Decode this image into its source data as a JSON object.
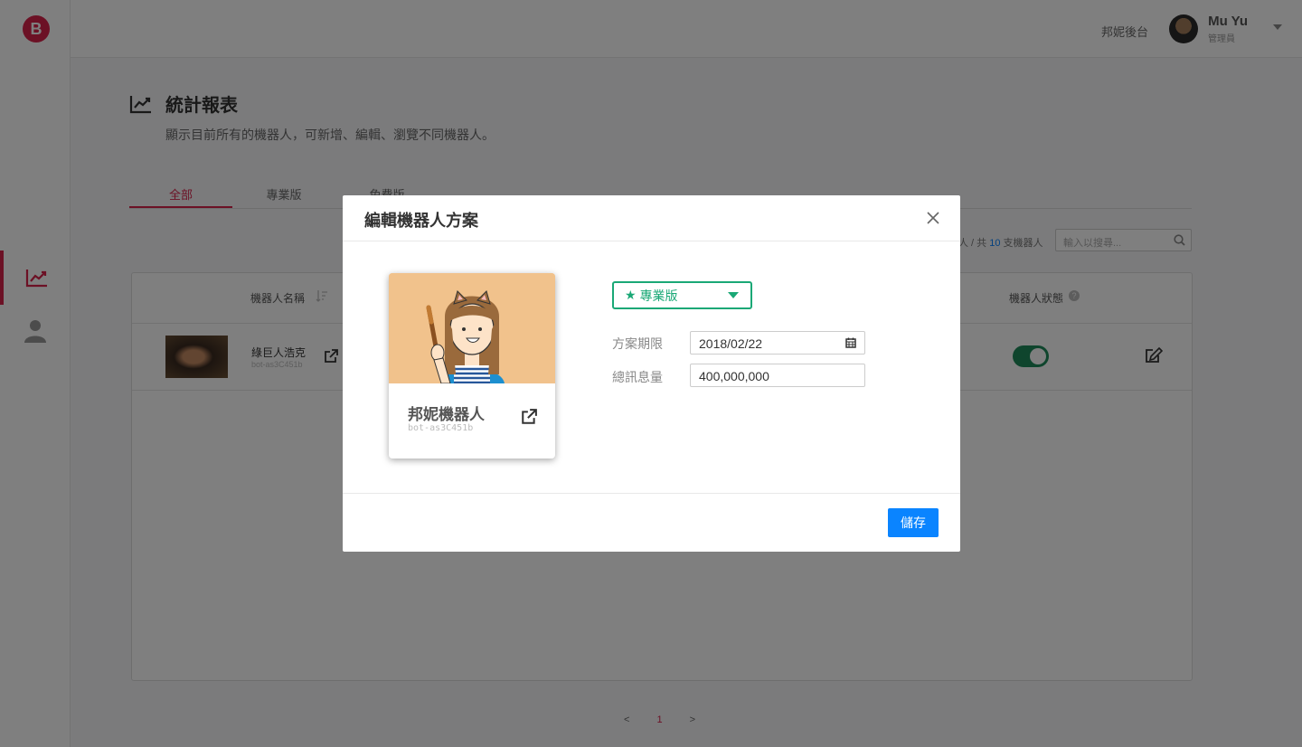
{
  "sidebar": {
    "logo_letter": "B",
    "items": [
      {
        "icon": "chart-line-icon",
        "active": true
      },
      {
        "icon": "user-icon",
        "active": false
      }
    ]
  },
  "header": {
    "backend_label": "邦妮後台",
    "user_name": "Mu Yu",
    "user_role": "管理員"
  },
  "page": {
    "title": "統計報表",
    "description": "顯示目前所有的機器人，可新增、編輯、瀏覽不同機器人。",
    "tabs": [
      "全部",
      "專業版",
      "免費版"
    ],
    "active_tab": 0,
    "count_prefix": "人 / 共",
    "count_value": "10",
    "count_suffix": "支機器人",
    "search_placeholder": "輸入以搜尋..."
  },
  "table": {
    "columns": {
      "name": "機器人名稱",
      "status": "機器人狀態"
    },
    "rows": [
      {
        "name": "綠巨人浩克",
        "id": "bot-as3C451b",
        "status_on": true
      }
    ]
  },
  "pagination": {
    "prev": "<",
    "current": "1",
    "next": ">"
  },
  "modal": {
    "title": "編輯機器人方案",
    "card": {
      "name": "邦妮機器人",
      "id": "bot-as3C451b"
    },
    "plan": {
      "star": "★",
      "selected": "專業版"
    },
    "fields": {
      "period_label": "方案期限",
      "period_value": "2018/02/22",
      "quota_label": "總訊息量",
      "quota_value": "400,000,000"
    },
    "save_label": "儲存"
  },
  "colors": {
    "brand": "#d9234b",
    "primary": "#0a84ff",
    "plan_green": "#1aa876",
    "toggle_on": "#1e8a5a"
  }
}
